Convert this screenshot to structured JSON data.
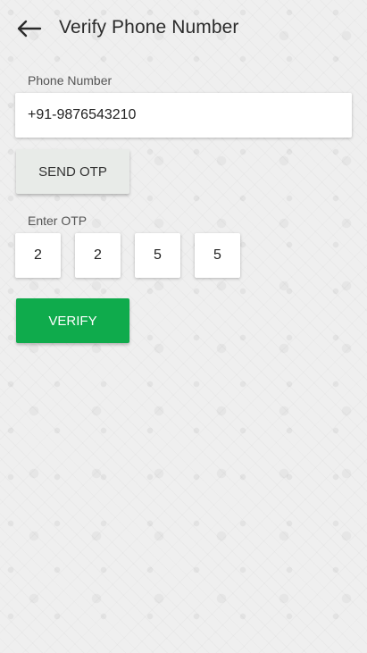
{
  "app_bar": {
    "title": "Verify Phone Number",
    "back_icon": "arrow-left-icon"
  },
  "phone": {
    "label": "Phone Number",
    "value": "+91-9876543210"
  },
  "send_otp": {
    "label": "SEND OTP"
  },
  "otp": {
    "label": "Enter OTP",
    "digits": [
      "2",
      "2",
      "5",
      "5"
    ]
  },
  "verify": {
    "label": "VERIFY"
  },
  "colors": {
    "verify_button": "#0fab4c",
    "send_otp_button": "#e8ebe8",
    "background": "#efefef"
  }
}
